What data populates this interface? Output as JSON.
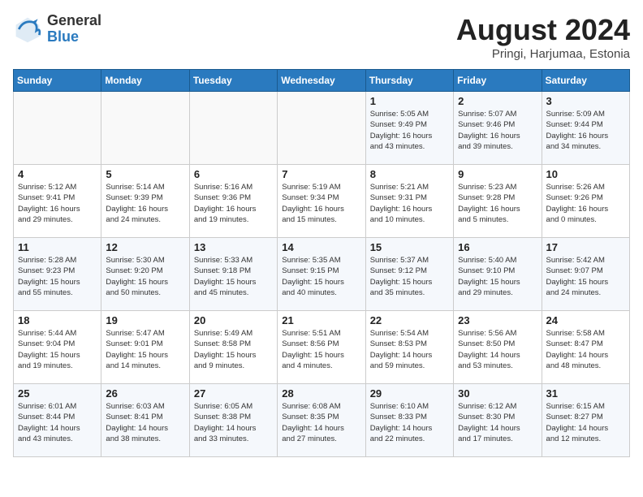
{
  "header": {
    "logo_general": "General",
    "logo_blue": "Blue",
    "month_title": "August 2024",
    "location": "Pringi, Harjumaa, Estonia"
  },
  "calendar": {
    "weekdays": [
      "Sunday",
      "Monday",
      "Tuesday",
      "Wednesday",
      "Thursday",
      "Friday",
      "Saturday"
    ],
    "weeks": [
      [
        {
          "day": "",
          "info": ""
        },
        {
          "day": "",
          "info": ""
        },
        {
          "day": "",
          "info": ""
        },
        {
          "day": "",
          "info": ""
        },
        {
          "day": "1",
          "info": "Sunrise: 5:05 AM\nSunset: 9:49 PM\nDaylight: 16 hours\nand 43 minutes."
        },
        {
          "day": "2",
          "info": "Sunrise: 5:07 AM\nSunset: 9:46 PM\nDaylight: 16 hours\nand 39 minutes."
        },
        {
          "day": "3",
          "info": "Sunrise: 5:09 AM\nSunset: 9:44 PM\nDaylight: 16 hours\nand 34 minutes."
        }
      ],
      [
        {
          "day": "4",
          "info": "Sunrise: 5:12 AM\nSunset: 9:41 PM\nDaylight: 16 hours\nand 29 minutes."
        },
        {
          "day": "5",
          "info": "Sunrise: 5:14 AM\nSunset: 9:39 PM\nDaylight: 16 hours\nand 24 minutes."
        },
        {
          "day": "6",
          "info": "Sunrise: 5:16 AM\nSunset: 9:36 PM\nDaylight: 16 hours\nand 19 minutes."
        },
        {
          "day": "7",
          "info": "Sunrise: 5:19 AM\nSunset: 9:34 PM\nDaylight: 16 hours\nand 15 minutes."
        },
        {
          "day": "8",
          "info": "Sunrise: 5:21 AM\nSunset: 9:31 PM\nDaylight: 16 hours\nand 10 minutes."
        },
        {
          "day": "9",
          "info": "Sunrise: 5:23 AM\nSunset: 9:28 PM\nDaylight: 16 hours\nand 5 minutes."
        },
        {
          "day": "10",
          "info": "Sunrise: 5:26 AM\nSunset: 9:26 PM\nDaylight: 16 hours\nand 0 minutes."
        }
      ],
      [
        {
          "day": "11",
          "info": "Sunrise: 5:28 AM\nSunset: 9:23 PM\nDaylight: 15 hours\nand 55 minutes."
        },
        {
          "day": "12",
          "info": "Sunrise: 5:30 AM\nSunset: 9:20 PM\nDaylight: 15 hours\nand 50 minutes."
        },
        {
          "day": "13",
          "info": "Sunrise: 5:33 AM\nSunset: 9:18 PM\nDaylight: 15 hours\nand 45 minutes."
        },
        {
          "day": "14",
          "info": "Sunrise: 5:35 AM\nSunset: 9:15 PM\nDaylight: 15 hours\nand 40 minutes."
        },
        {
          "day": "15",
          "info": "Sunrise: 5:37 AM\nSunset: 9:12 PM\nDaylight: 15 hours\nand 35 minutes."
        },
        {
          "day": "16",
          "info": "Sunrise: 5:40 AM\nSunset: 9:10 PM\nDaylight: 15 hours\nand 29 minutes."
        },
        {
          "day": "17",
          "info": "Sunrise: 5:42 AM\nSunset: 9:07 PM\nDaylight: 15 hours\nand 24 minutes."
        }
      ],
      [
        {
          "day": "18",
          "info": "Sunrise: 5:44 AM\nSunset: 9:04 PM\nDaylight: 15 hours\nand 19 minutes."
        },
        {
          "day": "19",
          "info": "Sunrise: 5:47 AM\nSunset: 9:01 PM\nDaylight: 15 hours\nand 14 minutes."
        },
        {
          "day": "20",
          "info": "Sunrise: 5:49 AM\nSunset: 8:58 PM\nDaylight: 15 hours\nand 9 minutes."
        },
        {
          "day": "21",
          "info": "Sunrise: 5:51 AM\nSunset: 8:56 PM\nDaylight: 15 hours\nand 4 minutes."
        },
        {
          "day": "22",
          "info": "Sunrise: 5:54 AM\nSunset: 8:53 PM\nDaylight: 14 hours\nand 59 minutes."
        },
        {
          "day": "23",
          "info": "Sunrise: 5:56 AM\nSunset: 8:50 PM\nDaylight: 14 hours\nand 53 minutes."
        },
        {
          "day": "24",
          "info": "Sunrise: 5:58 AM\nSunset: 8:47 PM\nDaylight: 14 hours\nand 48 minutes."
        }
      ],
      [
        {
          "day": "25",
          "info": "Sunrise: 6:01 AM\nSunset: 8:44 PM\nDaylight: 14 hours\nand 43 minutes."
        },
        {
          "day": "26",
          "info": "Sunrise: 6:03 AM\nSunset: 8:41 PM\nDaylight: 14 hours\nand 38 minutes."
        },
        {
          "day": "27",
          "info": "Sunrise: 6:05 AM\nSunset: 8:38 PM\nDaylight: 14 hours\nand 33 minutes."
        },
        {
          "day": "28",
          "info": "Sunrise: 6:08 AM\nSunset: 8:35 PM\nDaylight: 14 hours\nand 27 minutes."
        },
        {
          "day": "29",
          "info": "Sunrise: 6:10 AM\nSunset: 8:33 PM\nDaylight: 14 hours\nand 22 minutes."
        },
        {
          "day": "30",
          "info": "Sunrise: 6:12 AM\nSunset: 8:30 PM\nDaylight: 14 hours\nand 17 minutes."
        },
        {
          "day": "31",
          "info": "Sunrise: 6:15 AM\nSunset: 8:27 PM\nDaylight: 14 hours\nand 12 minutes."
        }
      ]
    ]
  }
}
